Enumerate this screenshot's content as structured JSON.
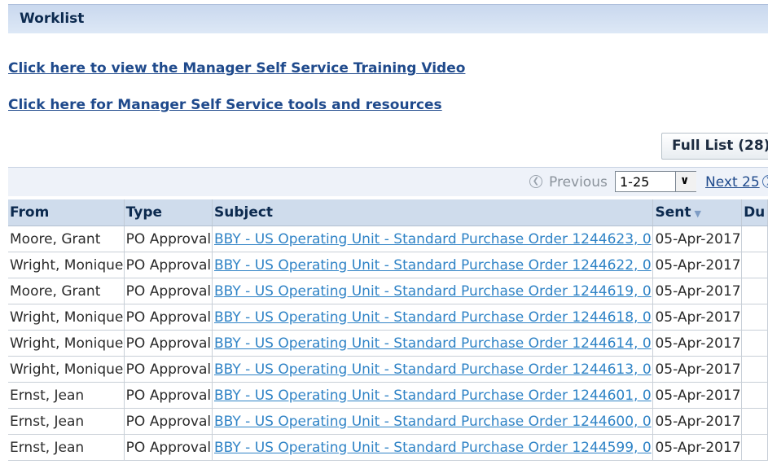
{
  "worklist": {
    "title": "Worklist"
  },
  "links": {
    "training_video": "Click here to view the Manager Self Service Training Video",
    "tools_resources": "Click here for Manager Self Service tools and resources"
  },
  "full_list_button": "Full List (28)",
  "pagination": {
    "previous_label": "Previous",
    "range_value": "1-25",
    "next_label": "Next 25"
  },
  "table": {
    "columns": [
      "From",
      "Type",
      "Subject",
      "Sent",
      "Du"
    ],
    "rows": [
      {
        "from": "Moore, Grant",
        "type": "PO Approval",
        "subject": "BBY - US Operating Unit - Standard Purchase Order 1244623, 0",
        "sent": "05-Apr-2017"
      },
      {
        "from": "Wright, Monique",
        "type": "PO Approval",
        "subject": "BBY - US Operating Unit - Standard Purchase Order 1244622, 0",
        "sent": "05-Apr-2017"
      },
      {
        "from": "Moore, Grant",
        "type": "PO Approval",
        "subject": "BBY - US Operating Unit - Standard Purchase Order 1244619, 0",
        "sent": "05-Apr-2017"
      },
      {
        "from": "Wright, Monique",
        "type": "PO Approval",
        "subject": "BBY - US Operating Unit - Standard Purchase Order 1244618, 0",
        "sent": "05-Apr-2017"
      },
      {
        "from": "Wright, Monique",
        "type": "PO Approval",
        "subject": "BBY - US Operating Unit - Standard Purchase Order 1244614, 0",
        "sent": "05-Apr-2017"
      },
      {
        "from": "Wright, Monique",
        "type": "PO Approval",
        "subject": "BBY - US Operating Unit - Standard Purchase Order 1244613, 0",
        "sent": "05-Apr-2017"
      },
      {
        "from": "Ernst, Jean",
        "type": "PO Approval",
        "subject": "BBY - US Operating Unit - Standard Purchase Order 1244601, 0",
        "sent": "05-Apr-2017"
      },
      {
        "from": "Ernst, Jean",
        "type": "PO Approval",
        "subject": "BBY - US Operating Unit - Standard Purchase Order 1244600, 0",
        "sent": "05-Apr-2017"
      },
      {
        "from": "Ernst, Jean",
        "type": "PO Approval",
        "subject": "BBY - US Operating Unit - Standard Purchase Order 1244599, 0",
        "sent": "05-Apr-2017"
      }
    ]
  },
  "colors": {
    "header_band": "#cfdcec",
    "link_dark": "#1f4a8c",
    "link_light": "#2f83c6"
  },
  "icons": {
    "previous": "circle-chevron-left-icon",
    "next": "circle-chevron-right-icon",
    "dropdown": "chevron-down-icon",
    "sort": "sort-descending-icon"
  }
}
